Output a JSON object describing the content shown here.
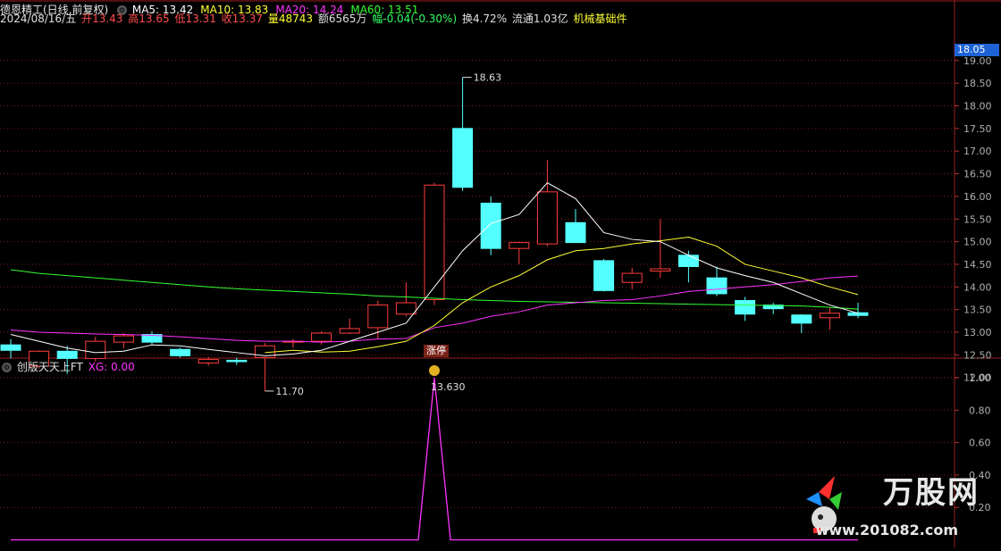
{
  "header": {
    "stock_name": "德恩精工(日线,前复权)",
    "ma_labels": [
      {
        "text": "MA5: 13.42",
        "color": "#ffffff"
      },
      {
        "text": "MA10: 13.83",
        "color": "#ffff33"
      },
      {
        "text": "MA20: 14.24",
        "color": "#ff33ff"
      },
      {
        "text": "MA60: 13.51",
        "color": "#33ff33"
      }
    ],
    "date": "2024/08/16/五",
    "open_label": "开",
    "open": "13.43",
    "high_label": "高",
    "high": "13.65",
    "low_label": "低",
    "low": "13.31",
    "close_label": "收",
    "close": "13.37",
    "vol_label": "量",
    "vol": "48743",
    "amount": "额6565万",
    "change": "幅-0.04(-0.30%)",
    "turnover": "换4.72%",
    "float": "流通1.03亿",
    "sector": "机械基础件"
  },
  "indicator": {
    "name": "创版天天上FT",
    "xg": "XG: 0.00",
    "peak_label": "13.630"
  },
  "price_tag": "18.05",
  "zhangting": "涨停",
  "annotations": {
    "high_mark": "18.63",
    "low_mark": "11.70"
  },
  "colors": {
    "up": "#ff3c3c",
    "down": "#54ffff",
    "ma5": "#ffffff",
    "ma10": "#ffff33",
    "ma20": "#ff33ff",
    "ma60": "#33ff33",
    "grid": "#7a1b1b",
    "axis": "#b0b0b0"
  },
  "watermark": {
    "title": "万股网",
    "url": "www.201082.com"
  },
  "chart_data": [
    {
      "type": "candlestick",
      "ylim": [
        11.5,
        19.3
      ],
      "yticks": [
        "19.00",
        "18.50",
        "18.00",
        "17.50",
        "17.00",
        "16.50",
        "16.00",
        "15.50",
        "15.00",
        "14.50",
        "14.00",
        "13.50",
        "13.00",
        "12.50",
        "12.00"
      ],
      "candles": [
        {
          "o": 12.72,
          "c": 12.6,
          "h": 12.85,
          "l": 12.42
        },
        {
          "o": 12.25,
          "c": 12.58,
          "h": 12.6,
          "l": 12.2
        },
        {
          "o": 12.58,
          "c": 12.42,
          "h": 12.7,
          "l": 12.08
        },
        {
          "o": 12.42,
          "c": 12.8,
          "h": 12.9,
          "l": 12.35
        },
        {
          "o": 12.78,
          "c": 12.92,
          "h": 12.98,
          "l": 12.65
        },
        {
          "o": 12.95,
          "c": 12.78,
          "h": 13.02,
          "l": 12.72
        },
        {
          "o": 12.62,
          "c": 12.48,
          "h": 12.66,
          "l": 12.44
        },
        {
          "o": 12.32,
          "c": 12.4,
          "h": 12.45,
          "l": 12.26
        },
        {
          "o": 12.38,
          "c": 12.35,
          "h": 12.44,
          "l": 12.28
        },
        {
          "o": 12.44,
          "c": 12.7,
          "h": 12.76,
          "l": 11.7
        },
        {
          "o": 12.8,
          "c": 12.8,
          "h": 12.85,
          "l": 12.66
        },
        {
          "o": 12.8,
          "c": 12.98,
          "h": 13.02,
          "l": 12.72
        },
        {
          "o": 12.98,
          "c": 13.08,
          "h": 13.3,
          "l": 12.96
        },
        {
          "o": 13.1,
          "c": 13.6,
          "h": 13.7,
          "l": 12.85
        },
        {
          "o": 13.4,
          "c": 13.65,
          "h": 14.1,
          "l": 13.35
        },
        {
          "o": 13.72,
          "c": 16.25,
          "h": 16.3,
          "l": 13.6
        },
        {
          "o": 17.5,
          "c": 16.2,
          "h": 18.63,
          "l": 16.12
        },
        {
          "o": 15.85,
          "c": 14.85,
          "h": 16.0,
          "l": 14.7
        },
        {
          "o": 14.85,
          "c": 14.98,
          "h": 15.0,
          "l": 14.5
        },
        {
          "o": 14.95,
          "c": 16.1,
          "h": 16.8,
          "l": 14.9
        },
        {
          "o": 15.42,
          "c": 14.98,
          "h": 15.72,
          "l": 14.98
        },
        {
          "o": 14.58,
          "c": 13.92,
          "h": 14.62,
          "l": 13.9
        },
        {
          "o": 14.1,
          "c": 14.3,
          "h": 14.42,
          "l": 13.95
        },
        {
          "o": 14.35,
          "c": 14.4,
          "h": 15.5,
          "l": 14.2
        },
        {
          "o": 14.7,
          "c": 14.45,
          "h": 14.8,
          "l": 14.1
        },
        {
          "o": 14.2,
          "c": 13.85,
          "h": 14.45,
          "l": 13.8
        },
        {
          "o": 13.7,
          "c": 13.4,
          "h": 13.78,
          "l": 13.25
        },
        {
          "o": 13.6,
          "c": 13.52,
          "h": 13.65,
          "l": 13.4
        },
        {
          "o": 13.38,
          "c": 13.2,
          "h": 13.4,
          "l": 12.98
        },
        {
          "o": 13.32,
          "c": 13.42,
          "h": 13.55,
          "l": 13.05
        },
        {
          "o": 13.43,
          "c": 13.37,
          "h": 13.65,
          "l": 13.31
        }
      ],
      "ma5": [
        12.95,
        12.8,
        12.65,
        12.55,
        12.58,
        12.72,
        12.7,
        12.62,
        12.55,
        12.48,
        12.52,
        12.6,
        12.8,
        13.0,
        13.2,
        14.0,
        14.8,
        15.4,
        15.6,
        16.3,
        15.95,
        15.2,
        15.05,
        15.0,
        14.7,
        14.42,
        14.25,
        14.1,
        13.85,
        13.6,
        13.42
      ],
      "ma10": [
        null,
        null,
        null,
        null,
        null,
        null,
        null,
        null,
        null,
        12.55,
        12.6,
        12.56,
        12.58,
        12.68,
        12.8,
        13.15,
        13.65,
        14.0,
        14.25,
        14.6,
        14.8,
        14.85,
        14.95,
        15.02,
        15.1,
        14.9,
        14.5,
        14.35,
        14.2,
        14.0,
        13.83
      ],
      "ma20": [
        13.05,
        13.0,
        12.98,
        12.96,
        12.95,
        12.93,
        12.9,
        12.86,
        12.82,
        12.8,
        12.8,
        12.78,
        12.8,
        12.85,
        12.86,
        13.1,
        13.2,
        13.35,
        13.45,
        13.6,
        13.65,
        13.7,
        13.72,
        13.8,
        13.9,
        13.95,
        14.0,
        14.05,
        14.12,
        14.2,
        14.24
      ],
      "ma60": [
        14.38,
        14.3,
        14.25,
        14.2,
        14.15,
        14.1,
        14.05,
        14.0,
        13.96,
        13.93,
        13.9,
        13.87,
        13.84,
        13.8,
        13.78,
        13.75,
        13.72,
        13.7,
        13.68,
        13.67,
        13.66,
        13.65,
        13.64,
        13.63,
        13.62,
        13.61,
        13.6,
        13.59,
        13.58,
        13.55,
        13.51
      ]
    },
    {
      "type": "line",
      "ylim": [
        0,
        1.1
      ],
      "yticks": [
        "1.00",
        "0.80",
        "0.60",
        "0.40",
        "0.20"
      ],
      "series": [
        {
          "values": [
            0,
            0,
            0,
            0,
            0,
            0,
            0,
            0,
            0,
            0,
            0,
            0,
            0,
            0,
            0,
            1,
            0,
            0,
            0,
            0,
            0,
            0,
            0,
            0,
            0,
            0,
            0,
            0,
            0,
            0,
            0
          ]
        }
      ]
    }
  ]
}
